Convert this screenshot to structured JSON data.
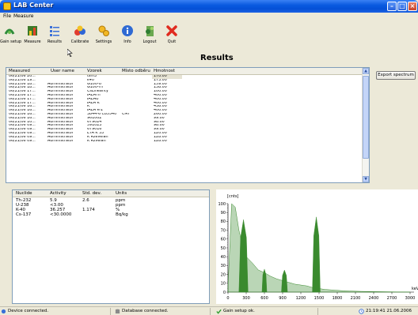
{
  "window": {
    "title": "LAB Center"
  },
  "menu": [
    "File",
    "Measure"
  ],
  "toolbar": {
    "buttons": [
      {
        "label": "Gain setup",
        "icon": "gain-setup-icon"
      },
      {
        "label": "Measure",
        "icon": "measure-icon"
      },
      {
        "label": "Results",
        "icon": "results-icon"
      },
      {
        "label": "Calibrate",
        "icon": "calibrate-icon"
      },
      {
        "label": "Settings",
        "icon": "settings-icon"
      },
      {
        "label": "Info",
        "icon": "info-icon"
      },
      {
        "label": "Logout",
        "icon": "logout-icon"
      },
      {
        "label": "Quit",
        "icon": "quit-icon"
      }
    ]
  },
  "page_title": "Results",
  "results_table": {
    "columns": [
      "Measured",
      "User name",
      "Vzorek",
      "Místo odběru",
      "Hmotnost"
    ],
    "rows": [
      [
        "06/21/06 20...",
        "",
        "tsm3",
        "",
        "170.00"
      ],
      [
        "06/21/06 19...",
        "",
        "k40",
        "",
        "173.00"
      ],
      [
        "06/21/06 18...",
        "Administrator",
        "G100-U",
        "",
        "159.00"
      ],
      [
        "06/21/06 18...",
        "Administrator",
        "G100-Th",
        "",
        "158.00"
      ],
      [
        "06/21/06 17...",
        "Administrator",
        "CsLinearity",
        "",
        "100.00"
      ],
      [
        "06/21/06 17...",
        "Administrator",
        "IAEATh",
        "",
        "400.00"
      ],
      [
        "06/21/06 17...",
        "Administrator",
        "IAEAU",
        "",
        "400.00"
      ],
      [
        "06/21/06 17...",
        "Administrator",
        "IAEA K",
        "",
        "400.00"
      ],
      [
        "06/21/06 16...",
        "Administrator",
        "K",
        "",
        "438.00"
      ],
      [
        "06/21/06 16...",
        "Administrator",
        "IAEA K-1",
        "",
        "400.00"
      ],
      [
        "06/21/06 16...",
        "Administrator",
        "3844-6 C85540",
        "CMI",
        "260.00"
      ],
      [
        "06/21/06 16...",
        "Administrator",
        "961002",
        "",
        "99.00"
      ],
      [
        "06/21/06 10...",
        "Administrator",
        "679024",
        "",
        "98.00"
      ],
      [
        "06/21/06 09...",
        "Administrator",
        "591023",
        "",
        "98.00"
      ],
      [
        "06/21/06 09...",
        "Administrator",
        "679016",
        "",
        "99.00"
      ],
      [
        "06/21/06 09...",
        "Administrator",
        "ETA K 33",
        "",
        "120.00"
      ],
      [
        "06/21/06 09...",
        "Administrator",
        "K Rževelan",
        "",
        "128.00"
      ],
      [
        "06/21/06 09...",
        "Administrator",
        "K Ržvelan",
        "",
        "128.00"
      ]
    ]
  },
  "export_button": "Export spectrum",
  "nuclide_table": {
    "columns": [
      "Nuclide",
      "Activity",
      "Std. dev.",
      "Units"
    ],
    "rows": [
      [
        "Th-232",
        "5.9",
        "2.6",
        "ppm"
      ],
      [
        "U-238",
        "<3.00",
        "",
        "ppm"
      ],
      [
        "K-40",
        "36.257",
        "1.174",
        "%"
      ],
      [
        "Cs-137",
        "<30.0000",
        "",
        "Bq/kg"
      ]
    ]
  },
  "chart_data": {
    "type": "area",
    "ylabel": "[cnts]",
    "xlabel": "keV",
    "xlim": [
      0,
      3000
    ],
    "ylim": [
      0,
      100
    ],
    "x_ticks": [
      0,
      300,
      600,
      900,
      1200,
      1500,
      1800,
      2100,
      2400,
      2700,
      3000
    ],
    "y_ticks": [
      0,
      10,
      20,
      30,
      40,
      50,
      60,
      70,
      80,
      90,
      100
    ],
    "color": "#3a8a2e",
    "continuum": {
      "x": [
        0,
        60,
        120,
        180,
        240,
        300,
        400,
        500,
        600,
        700,
        800,
        900,
        1000,
        1100,
        1200,
        1300,
        1400,
        1500,
        1600,
        1700,
        1800,
        1900,
        2000,
        2100,
        2200,
        2400,
        2600,
        2800,
        3000
      ],
      "y": [
        5,
        100,
        96,
        70,
        52,
        40,
        33,
        25,
        22,
        18,
        15,
        13,
        11,
        9,
        8,
        7,
        5,
        4,
        3,
        2.5,
        2,
        1.5,
        1.2,
        1,
        0.8,
        0.6,
        0.4,
        0.2,
        0.1
      ]
    },
    "peaks": [
      {
        "x0": 180,
        "x1": 330,
        "y": 82
      },
      {
        "x0": 560,
        "x1": 640,
        "y": 26
      },
      {
        "x0": 880,
        "x1": 980,
        "y": 25
      },
      {
        "x0": 1390,
        "x1": 1520,
        "y": 85
      }
    ]
  },
  "status": {
    "device": "Device connected.",
    "database": "Database connected.",
    "gain": "Gain setup ok.",
    "clock": "21:19:41 21.06.2006"
  }
}
